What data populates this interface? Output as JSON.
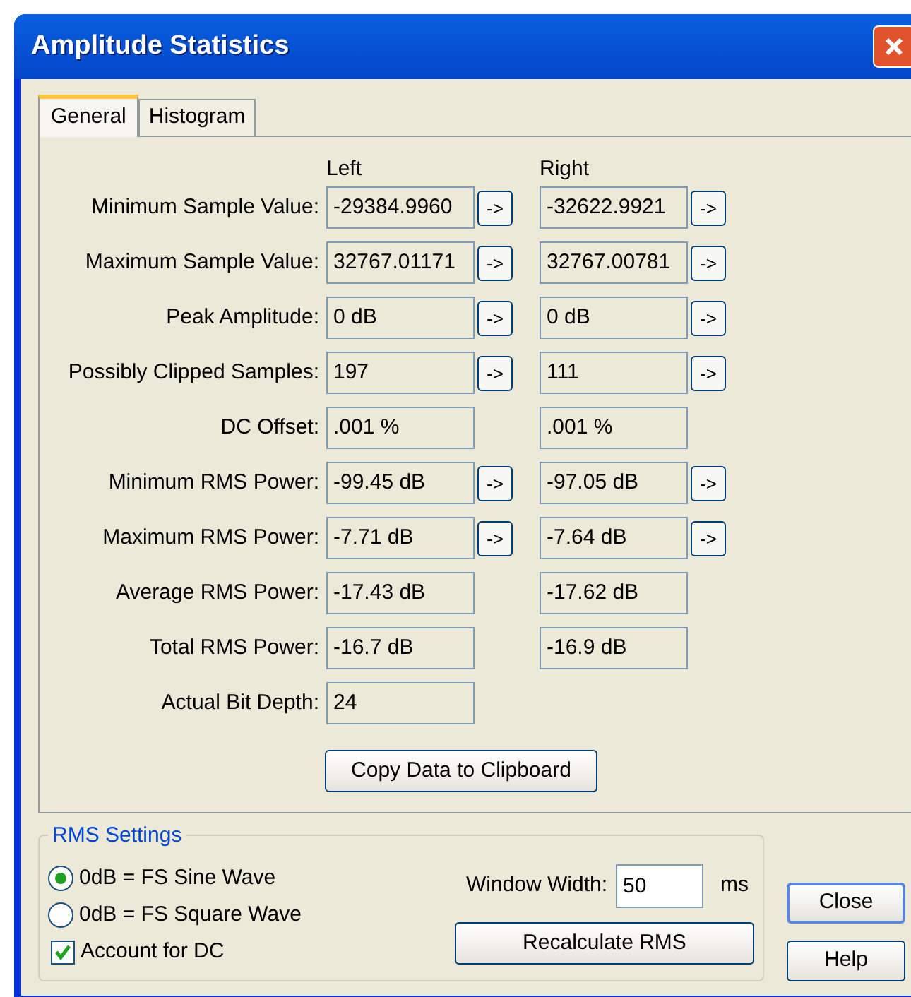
{
  "window": {
    "title": "Amplitude Statistics"
  },
  "tabs": [
    {
      "label": "General",
      "selected": true
    },
    {
      "label": "Histogram",
      "selected": false
    }
  ],
  "columns": [
    "Left",
    "Right"
  ],
  "rows": [
    {
      "label": "Minimum Sample Value:",
      "cells": [
        {
          "value": "-29384.9960",
          "button": "->"
        },
        {
          "value": "-32622.9921",
          "button": "->"
        }
      ]
    },
    {
      "label": "Maximum Sample Value:",
      "cells": [
        {
          "value": "32767.01171",
          "button": "->"
        },
        {
          "value": "32767.00781",
          "button": "->"
        }
      ]
    },
    {
      "label": "Peak Amplitude:",
      "cells": [
        {
          "value": "0 dB",
          "button": "->"
        },
        {
          "value": "0 dB",
          "button": "->"
        }
      ]
    },
    {
      "label": "Possibly Clipped Samples:",
      "cells": [
        {
          "value": "197",
          "button": "->"
        },
        {
          "value": "111",
          "button": "->"
        }
      ]
    },
    {
      "label": "DC Offset:",
      "cells": [
        {
          "value": ".001 %"
        },
        {
          "value": ".001 %"
        }
      ]
    },
    {
      "label": "Minimum RMS Power:",
      "cells": [
        {
          "value": "-99.45 dB",
          "button": "->"
        },
        {
          "value": "-97.05 dB",
          "button": "->"
        }
      ]
    },
    {
      "label": "Maximum RMS Power:",
      "cells": [
        {
          "value": "-7.71 dB",
          "button": "->"
        },
        {
          "value": "-7.64 dB",
          "button": "->"
        }
      ]
    },
    {
      "label": "Average RMS Power:",
      "cells": [
        {
          "value": "-17.43 dB"
        },
        {
          "value": "-17.62 dB"
        }
      ]
    },
    {
      "label": "Total RMS Power:",
      "cells": [
        {
          "value": "-16.7 dB"
        },
        {
          "value": "-16.9 dB"
        }
      ]
    },
    {
      "label": "Actual Bit Depth:",
      "cells": [
        {
          "value": "24"
        }
      ]
    }
  ],
  "copy_button": "Copy Data to Clipboard",
  "rms_settings": {
    "title": "RMS Settings",
    "options": [
      {
        "label": "0dB = FS Sine Wave",
        "selected": true
      },
      {
        "label": "0dB = FS Square Wave",
        "selected": false
      }
    ],
    "account_for_dc": {
      "label": "Account for DC",
      "checked": true
    },
    "window_width": {
      "label": "Window Width:",
      "value": "50",
      "unit": "ms"
    },
    "recalculate_button": "Recalculate RMS"
  },
  "buttons": [
    "Close",
    "Help"
  ]
}
